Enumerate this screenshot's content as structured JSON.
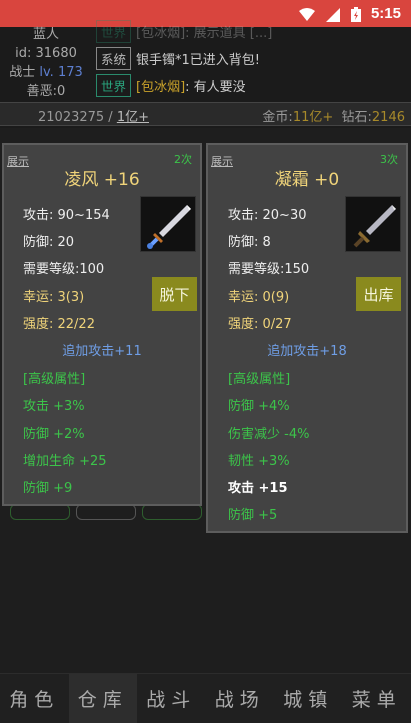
{
  "status": {
    "time": "5:15"
  },
  "player": {
    "name": "蓝人",
    "id": "id: 31680",
    "class": "战士",
    "level": "lv. 173",
    "karma": "善恶:0"
  },
  "chat": [
    {
      "channel": "世界",
      "text": "[包冰烟]: 展示道具 [...]",
      "kind": "world"
    },
    {
      "channel": "系统",
      "text": "银手镯*1已进入背包!",
      "kind": "system"
    },
    {
      "channel": "世界",
      "name": "[包冰烟]",
      "text": ": 有人要没",
      "kind": "world"
    }
  ],
  "moneybar": {
    "bag_id": "21023275",
    "bag_sep": " / ",
    "bag_cap": "1亿+",
    "gold_label": "金币:",
    "gold": "11亿+",
    "dia_label": "钻石:",
    "dia": "2146"
  },
  "left_item": {
    "show": "展示",
    "count": "2次",
    "title": "凌风 +16",
    "attack": "攻击: 90~154",
    "defense": "防御: 20",
    "req": "需要等级:100",
    "luck": "幸运: 3(3)",
    "strength": "强度: 22/22",
    "extra": "追加攻击+11",
    "adv": "[高级属性]",
    "props": [
      "攻击 +3%",
      "防御 +2%",
      "增加生命 +25",
      "防御 +9"
    ],
    "button": "脱下"
  },
  "right_item": {
    "show": "展示",
    "count": "3次",
    "title": "凝霜 +0",
    "attack": "攻击: 20~30",
    "defense": "防御: 8",
    "req": "需要等级:150",
    "luck": "幸运: 0(9)",
    "strength": "强度: 0/27",
    "extra": "追加攻击+18",
    "adv": "[高级属性]",
    "props": [
      "防御 +4%",
      "伤害减少 -4%",
      "韧性 +3%",
      "攻击 +15",
      "防御 +5"
    ],
    "button": "出库"
  },
  "nav": [
    "角色",
    "仓库",
    "战斗",
    "战场",
    "城镇",
    "菜单"
  ]
}
